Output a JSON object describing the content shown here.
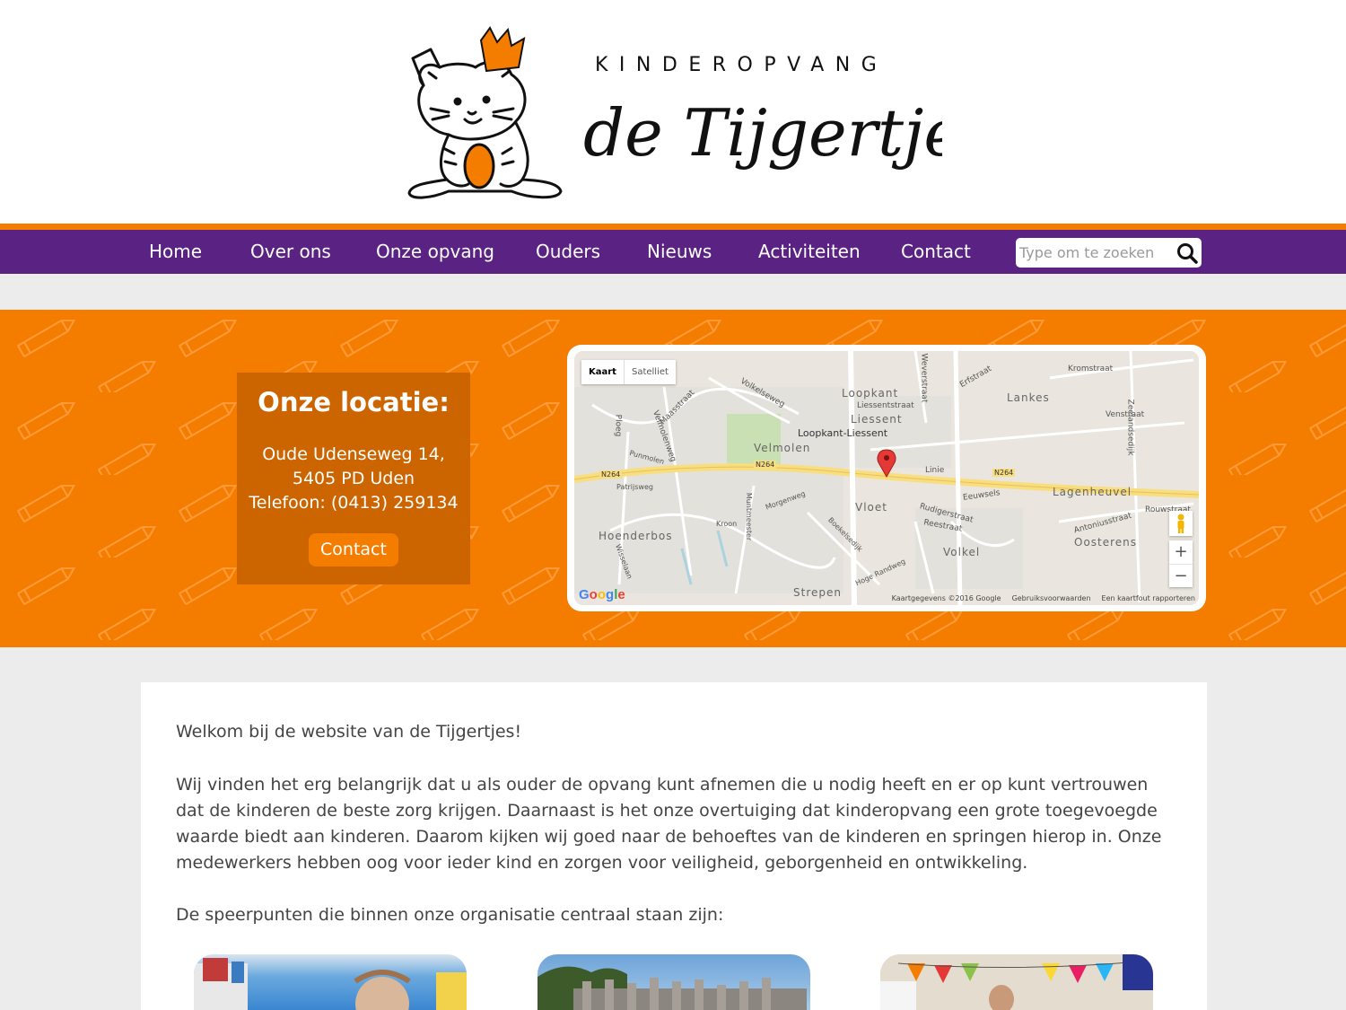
{
  "header": {
    "logo_top": "KINDEROPVANG",
    "logo_brand": "de Tijgertjes"
  },
  "nav": {
    "items": [
      "Home",
      "Over ons",
      "Onze opvang",
      "Ouders",
      "Nieuws",
      "Activiteiten",
      "Contact"
    ],
    "search_placeholder": "Type om te zoeken"
  },
  "location": {
    "title": "Onze locatie:",
    "address_line1": "Oude Udenseweg 14,",
    "address_line2": "5405 PD Uden",
    "phone": "Telefoon: (0413) 259134",
    "button": "Contact"
  },
  "map": {
    "type_map": "Kaart",
    "type_satellite": "Satelliet",
    "zoom_in": "+",
    "zoom_out": "−",
    "google": "Google",
    "footer_data": "Kaartgegevens ©2016 Google",
    "footer_terms": "Gebruiksvoorwaarden",
    "footer_report": "Een kaartfout rapporteren",
    "labels": {
      "loopkant": "Loopkant",
      "liessent_street": "Liessentstraat",
      "liessent": "Liessent",
      "loopkant_liessent": "Loopkant-Liessent",
      "lankes": "Lankes",
      "velmolen": "Velmolen",
      "vloet": "Vloet",
      "lagenheuvel": "Lagenheuvel",
      "oosterens": "Oosterens",
      "volkel": "Volkel",
      "hoenderbos": "Hoenderbos",
      "strepen": "Strepen",
      "n264": "N264",
      "kromstraat": "Kromstraat",
      "venstraat": "Venstraat",
      "erfstraat": "Erfstraat",
      "weverstraat": "Weverstraat",
      "linie": "Linie",
      "eeuwsels": "Eeuwsels",
      "rudigerstraat": "Rudigerstraat",
      "reestraat": "Reestraat",
      "rouwstraat": "Rouwstraat",
      "antoniusstraat": "Antoniusstraat",
      "zeelandsedijk": "Zeelandsedijk",
      "volkelseweg": "Volkelseweg",
      "maasstraat": "Maasstraat",
      "velmolenweg": "Velmolenweg",
      "ploeg": "Ploeg",
      "punmolen": "Punmolen",
      "patrijsweg": "Patrijsweg",
      "morgenweg": "Morgenweg",
      "muntmeester": "Muntmeester",
      "kroon": "Kroon",
      "boekelsedijk": "Boekelsedijk",
      "hoge_randweg": "Hoge Randweg",
      "wisselaan": "Wisselaan"
    }
  },
  "content": {
    "welcome": "Welkom bij de website van de Tijgertjes!",
    "intro": "Wij vinden het erg belangrijk dat u als ouder de opvang kunt afnemen die u nodig heeft en er op kunt vertrouwen dat de kinderen de beste zorg krijgen. Daarnaast is het onze overtuiging dat kinderopvang een grote toegevoegde waarde biedt aan kinderen. Daarom kijken wij goed naar de behoeftes van de kinderen en springen hierop in. Onze medewerkers hebben oog voor ieder kind en zorgen voor veiligheid, geborgenheid en ontwikkeling.",
    "speerpunten": "De speerpunten die binnen onze organisatie centraal staan zijn:"
  },
  "colors": {
    "orange": "#f47d00",
    "purple": "#5a2383",
    "dark_orange": "#cc6400"
  }
}
